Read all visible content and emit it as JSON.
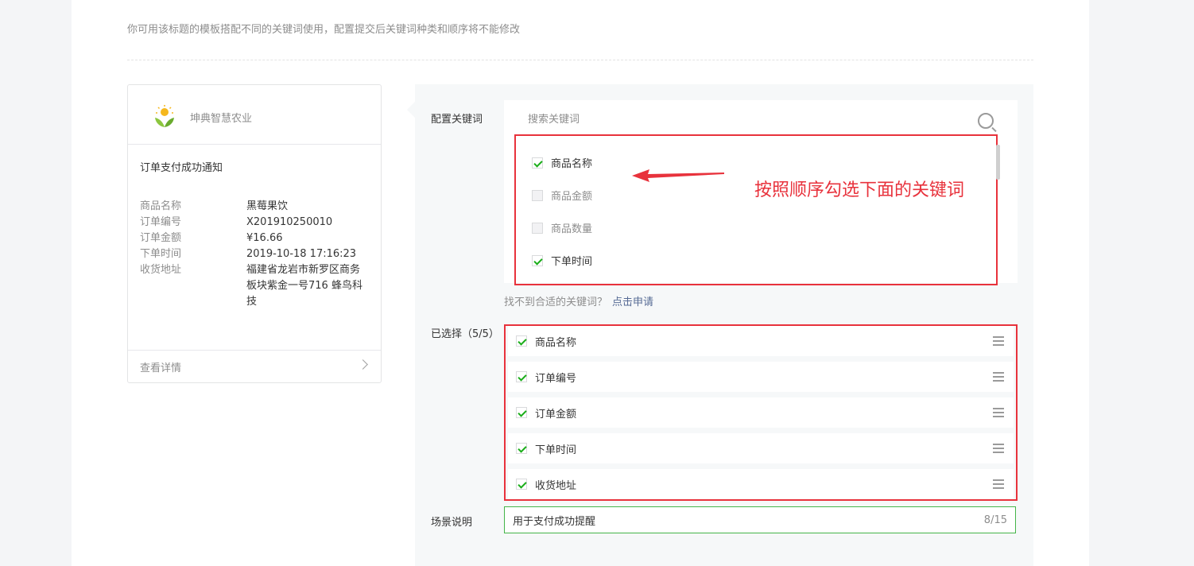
{
  "hint": "你可用该标题的模板搭配不同的关键词使用，配置提交后关键词种类和顺序将不能修改",
  "preview": {
    "account_name": "坤典智慧农业",
    "title": "订单支付成功通知",
    "fields": [
      {
        "label": "商品名称",
        "value": "黑莓果饮"
      },
      {
        "label": "订单编号",
        "value": "X201910250010"
      },
      {
        "label": "订单金额",
        "value": "¥16.66"
      },
      {
        "label": "下单时间",
        "value": "2019-10-18 17:16:23"
      },
      {
        "label": "收货地址",
        "value": "福建省龙岩市新罗区商务板块紫金一号716 蜂鸟科技"
      }
    ],
    "detail_link": "查看详情"
  },
  "config": {
    "keywords_label": "配置关键词",
    "search_placeholder": "搜索关键词",
    "keywords": [
      {
        "label": "商品名称",
        "checked": true
      },
      {
        "label": "商品金额",
        "checked": false
      },
      {
        "label": "商品数量",
        "checked": false
      },
      {
        "label": "下单时间",
        "checked": true
      }
    ],
    "annotation": "按照顺序勾选下面的关键词",
    "not_found": "找不到合适的关键词？",
    "apply_link": "点击申请",
    "selected_label": "已选择（5/5）",
    "selected": [
      "商品名称",
      "订单编号",
      "订单金额",
      "下单时间",
      "收货地址"
    ],
    "scene_label": "场景说明",
    "scene_value": "用于支付成功提醒",
    "scene_counter": "8/15"
  },
  "colors": {
    "accent_green": "#1aad19",
    "annotation_red": "#e8323c",
    "link_blue": "#576b95"
  },
  "icons": [
    "logo-icon",
    "chevron-right-icon",
    "search-icon",
    "checkbox-icon",
    "arrow-icon",
    "drag-handle-icon"
  ]
}
